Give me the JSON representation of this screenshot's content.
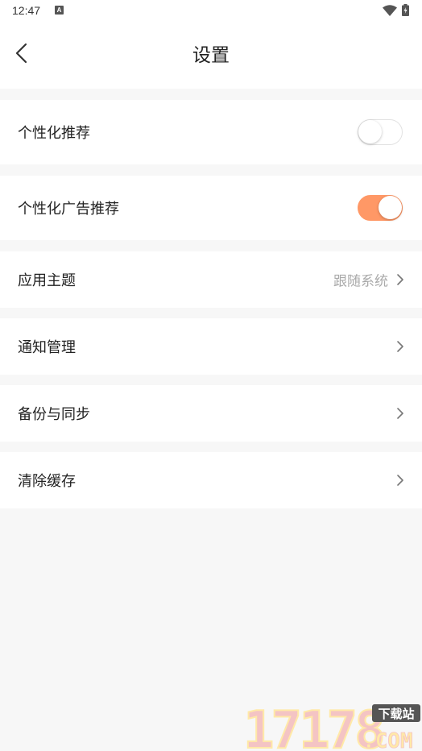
{
  "status_bar": {
    "time": "12:47",
    "notification_icon_letter": "A"
  },
  "header": {
    "title": "设置",
    "back_icon": "chevron-left-icon"
  },
  "settings": {
    "personalized_recommend": {
      "label": "个性化推荐",
      "enabled": false
    },
    "personalized_ads": {
      "label": "个性化广告推荐",
      "enabled": true
    },
    "app_theme": {
      "label": "应用主题",
      "value": "跟随系统"
    },
    "notification_manage": {
      "label": "通知管理"
    },
    "backup_sync": {
      "label": "备份与同步"
    },
    "clear_cache": {
      "label": "清除缓存"
    }
  },
  "watermark": {
    "number": "17178",
    "tag": "下载站",
    "suffix": ".COM"
  },
  "colors": {
    "accent": "#ff9866",
    "page_background": "#f7f7f7",
    "card_background": "#ffffff",
    "secondary_text": "#aaaaaa"
  }
}
